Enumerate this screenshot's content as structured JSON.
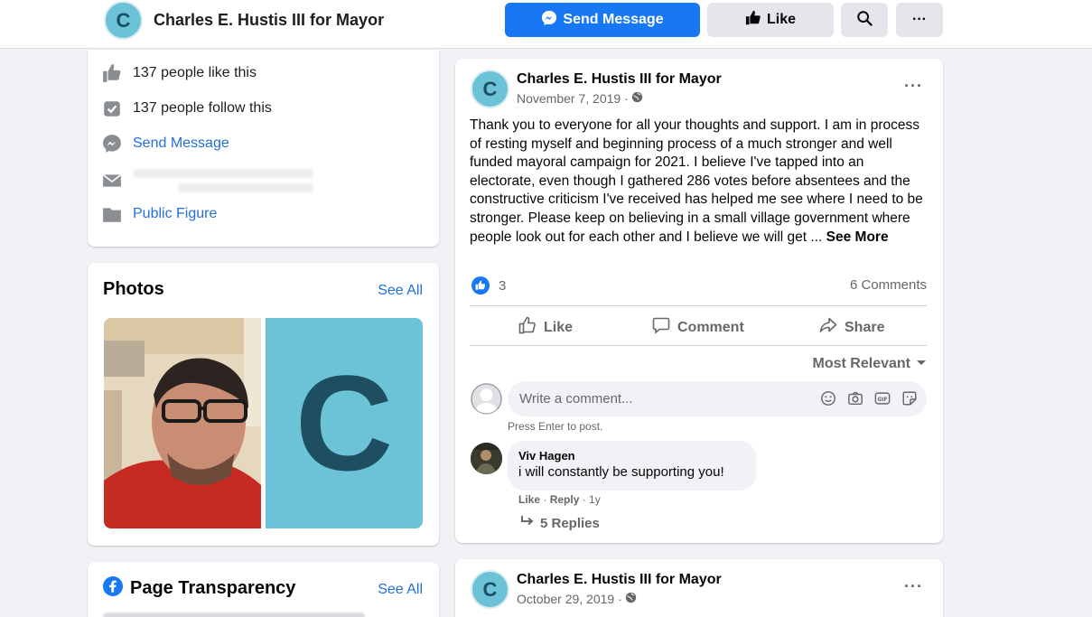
{
  "header": {
    "page_name": "Charles E. Hustis III for Mayor",
    "avatar_letter": "C",
    "send_message_label": "Send Message",
    "like_label": "Like",
    "more_label": "···"
  },
  "about": {
    "likes_text": "137 people like this",
    "follows_text": "137 people follow this",
    "send_message_link": "Send Message",
    "category_link": "Public Figure"
  },
  "photos": {
    "title": "Photos",
    "see_all": "See All",
    "logo_letter": "C"
  },
  "transparency": {
    "title": "Page Transparency",
    "see_all": "See All"
  },
  "post": {
    "author": "Charles E. Hustis III for Mayor",
    "avatar_letter": "C",
    "date": "November 7, 2019 ·",
    "more": "···",
    "text": "Thank you to everyone for all your thoughts and support.  I am in process of resting myself and beginning process of a much stronger and well funded mayoral campaign for 2021.  I believe I've tapped into an electorate, even though I gathered 286 votes before absentees and the constructive criticism I've received has helped me see where I need to be stronger.  Please keep on believing in a small village government where people look out for each other and I believe we will get ... ",
    "see_more": "See More",
    "reaction_count": "3",
    "comment_count": "6 Comments",
    "actions": {
      "like": "Like",
      "comment": "Comment",
      "share": "Share"
    },
    "sort_label": "Most Relevant",
    "comment_placeholder": "Write a comment...",
    "press_enter": "Press Enter to post.",
    "comment": {
      "author": "Viv Hagen",
      "text": "i will constantly be supporting you!",
      "like": "Like",
      "reply": "Reply",
      "age": "· 1y"
    },
    "replies": "5 Replies"
  },
  "post2": {
    "author": "Charles E. Hustis III for Mayor",
    "avatar_letter": "C",
    "date": "October 29, 2019 ·",
    "more": "···"
  },
  "colors": {
    "brand_blue": "#1877f2",
    "avatar_teal": "#6cc2d6",
    "avatar_text": "#1d4f61"
  }
}
